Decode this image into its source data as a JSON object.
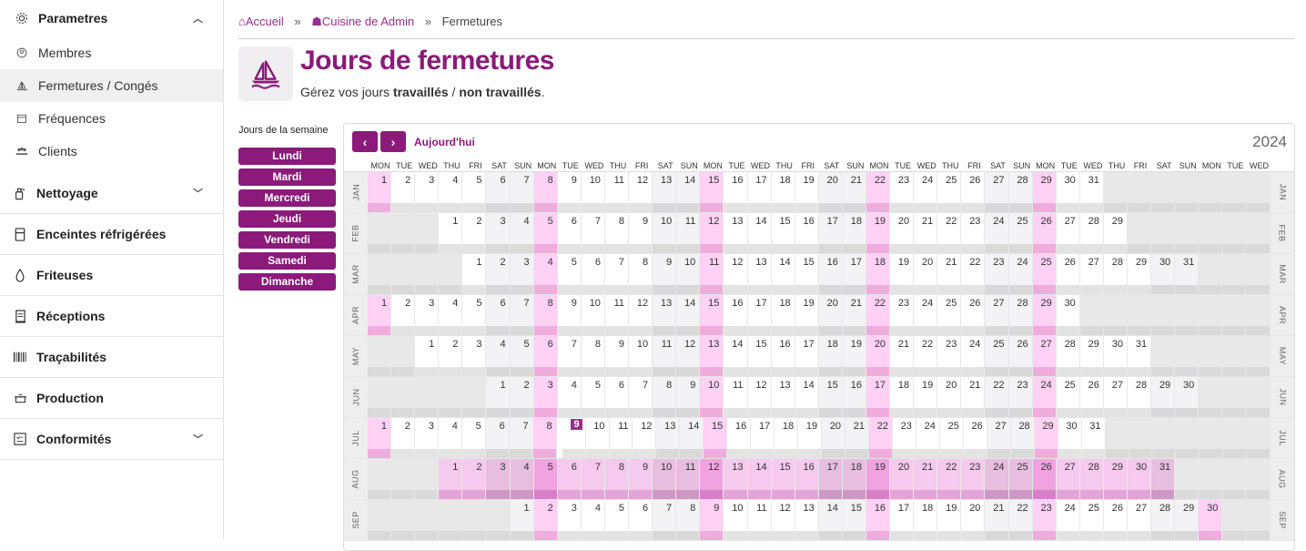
{
  "sidebar": {
    "parametres": "Parametres",
    "sub_items": [
      "Membres",
      "Fermetures / Congés",
      "Fréquences",
      "Clients"
    ],
    "sections": [
      "Nettoyage",
      "Enceintes réfrigérées",
      "Friteuses",
      "Réceptions",
      "Traçabilités",
      "Production",
      "Conformités"
    ]
  },
  "breadcrumb": {
    "home": "Accueil",
    "kitchen": "Cuisine de Admin",
    "current": "Fermetures",
    "separator": "»"
  },
  "header": {
    "title": "Jours de fermetures",
    "subtitle_prefix": "Gérez vos jours ",
    "subtitle_bold1": "travaillés",
    "subtitle_mid": " / ",
    "subtitle_bold2": "non travaillés",
    "subtitle_end": "."
  },
  "weekdays_panel": {
    "label": "Jours de la semaine",
    "days": [
      "Lundi",
      "Mardi",
      "Mercredi",
      "Jeudi",
      "Vendredi",
      "Samedi",
      "Dimanche"
    ]
  },
  "calendar": {
    "prev": "‹",
    "next": "›",
    "today_label": "Aujourd'hui",
    "year": "2024",
    "dow": [
      "MON",
      "TUE",
      "WED",
      "THU",
      "FRI",
      "SAT",
      "SUN",
      "MON",
      "TUE",
      "WED",
      "THU",
      "FRI",
      "SAT",
      "SUN",
      "MON",
      "TUE",
      "WED",
      "THU",
      "FRI",
      "SAT",
      "SUN",
      "MON",
      "TUE",
      "WED",
      "THU",
      "FRI",
      "SAT",
      "SUN",
      "MON",
      "TUE",
      "WED",
      "THU",
      "FRI",
      "SAT",
      "SUN",
      "MON",
      "TUE",
      "WED"
    ],
    "today": {
      "month": 6,
      "day": 9
    },
    "months": [
      {
        "label": "JAN",
        "offset": 0,
        "days": 31,
        "holidays": []
      },
      {
        "label": "FEB",
        "offset": 3,
        "days": 29,
        "holidays": []
      },
      {
        "label": "MAR",
        "offset": 4,
        "days": 31,
        "holidays": []
      },
      {
        "label": "APR",
        "offset": 0,
        "days": 30,
        "holidays": []
      },
      {
        "label": "MAY",
        "offset": 2,
        "days": 31,
        "holidays": []
      },
      {
        "label": "JUN",
        "offset": 5,
        "days": 30,
        "holidays": []
      },
      {
        "label": "JUL",
        "offset": 0,
        "days": 31,
        "holidays": []
      },
      {
        "label": "AUG",
        "offset": 3,
        "days": 31,
        "holidays": [
          1,
          2,
          3,
          4,
          5,
          6,
          7,
          8,
          9,
          10,
          11,
          12,
          13,
          14,
          15,
          16,
          17,
          18,
          19,
          20,
          21,
          22,
          23,
          24,
          25,
          26,
          27,
          28,
          29,
          30,
          31
        ]
      },
      {
        "label": "SEP",
        "offset": 6,
        "days": 30,
        "holidays": []
      }
    ]
  }
}
